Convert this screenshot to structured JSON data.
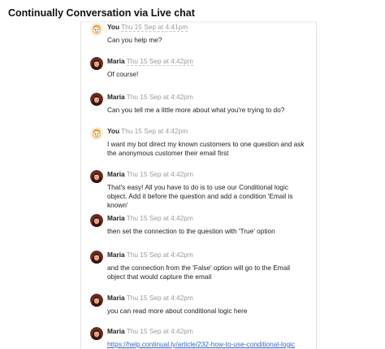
{
  "page": {
    "title": "Continually Conversation via Live chat"
  },
  "conversation": {
    "messages": [
      {
        "sender": "You",
        "avatar": "bot-face-icon",
        "time": "Thu 15 Sep at 4:41pm",
        "text": "Can you help me?"
      },
      {
        "sender": "Maria",
        "avatar": "maria-avatar",
        "time": "Thu 15 Sep at 4:42pm",
        "text": "Of course!"
      },
      {
        "sender": "Maria",
        "avatar": "maria-avatar",
        "time": "Thu 15 Sep at 4:42pm",
        "text": "Can you tell me a little more about what you're trying to do?"
      },
      {
        "sender": "You",
        "avatar": "bot-face-icon",
        "time": "Thu 15 Sep at 4:42pm",
        "text": "I want my bot direct my known customers to one question and ask the anonymous customer their email first"
      },
      {
        "sender": "Maria",
        "avatar": "maria-avatar",
        "time": "Thu 15 Sep at 4:42pm",
        "text": "That's easy! All you have to do is to use our Conditional logic object. Add it before the question and add a condition 'Email is known'"
      },
      {
        "sender": "Maria",
        "avatar": "maria-avatar",
        "time": "Thu 15 Sep at 4:42pm",
        "text": "then set the connection to the question with 'True' option"
      },
      {
        "sender": "Maria",
        "avatar": "maria-avatar",
        "time": "Thu 15 Sep at 4:42pm",
        "text": "and the connection from the 'False' option will go to the Email object that would capture the email"
      },
      {
        "sender": "Maria",
        "avatar": "maria-avatar",
        "time": "Thu 15 Sep at 4:42pm",
        "text": "you can read more about conditional logic here"
      },
      {
        "sender": "Maria",
        "avatar": "maria-avatar",
        "time": "Thu 15 Sep at 4:42pm",
        "link": "https://help.continual.ly/article/232-how-to-use-conditional-logic"
      }
    ]
  },
  "colors": {
    "link": "#2a6ad6",
    "timestamp": "#9a9a9a",
    "bot_avatar": "#f5b041"
  }
}
